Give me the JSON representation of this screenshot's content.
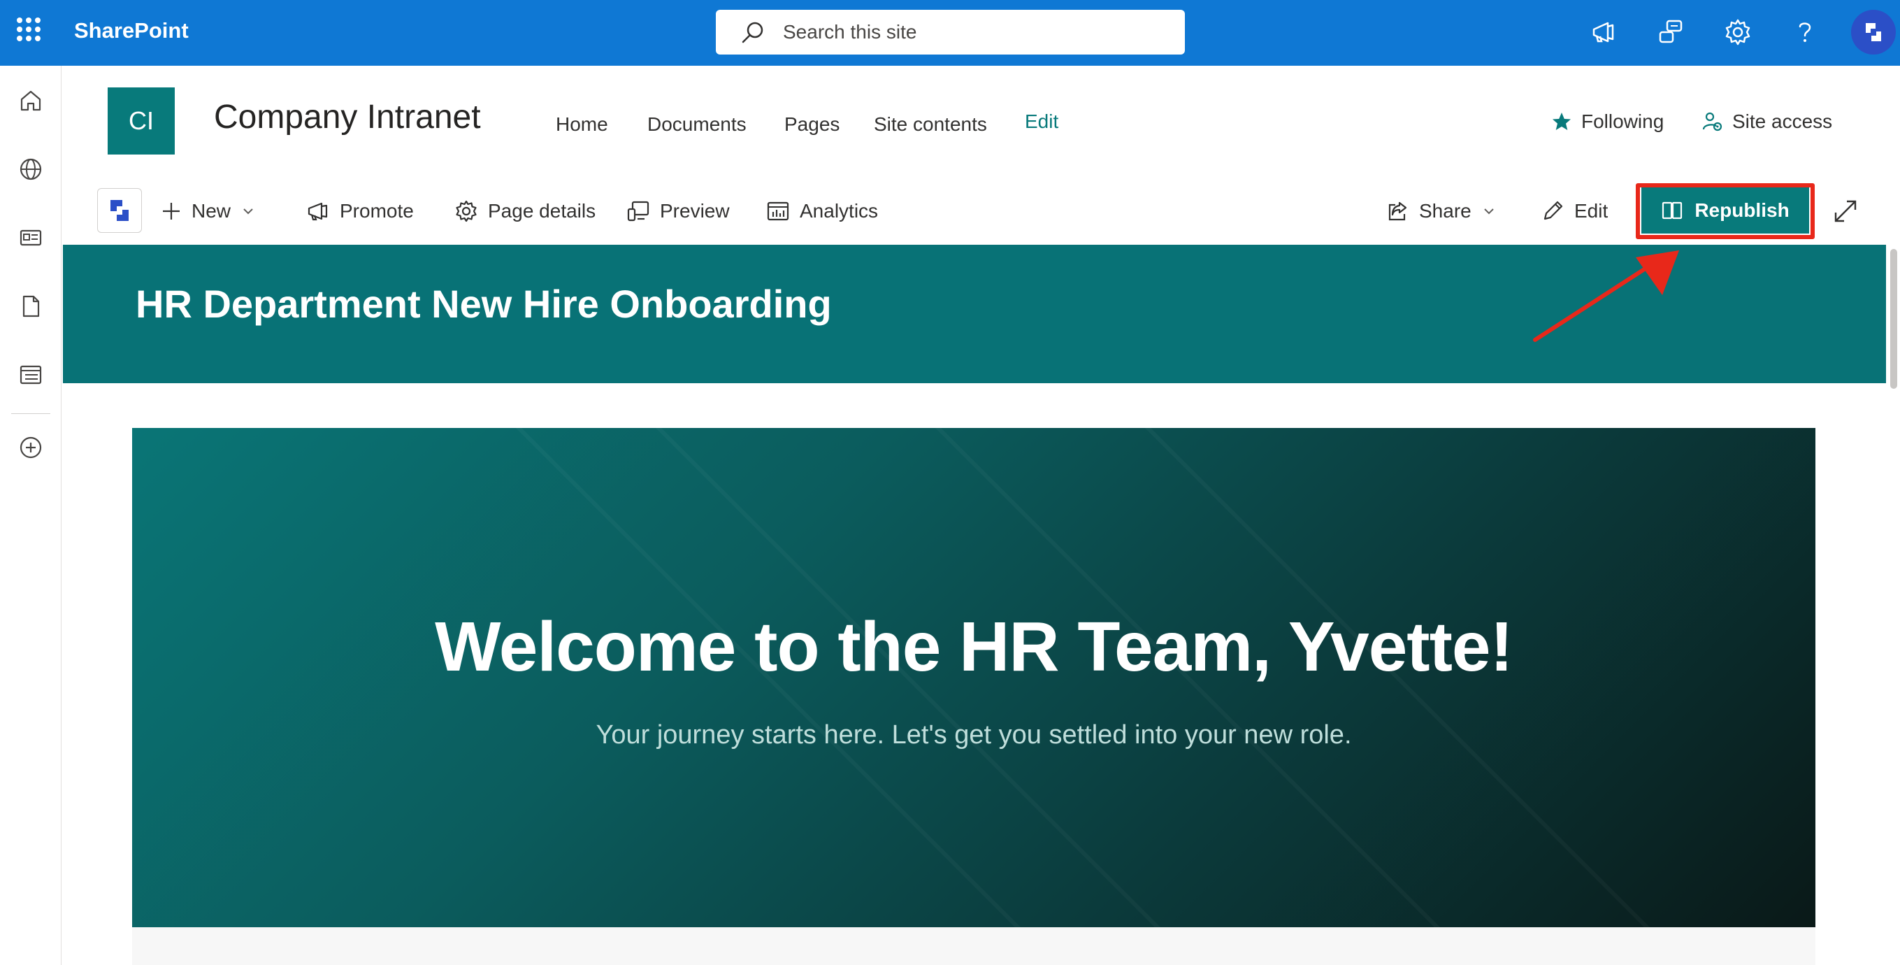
{
  "suite_bar": {
    "app_name": "SharePoint",
    "search": {
      "placeholder": "Search this site",
      "value": ""
    },
    "icons": [
      "megaphone-icon",
      "feedback-icon",
      "gear-icon",
      "help-icon"
    ]
  },
  "site": {
    "logo_initials": "CI",
    "title": "Company Intranet",
    "nav": [
      {
        "label": "Home"
      },
      {
        "label": "Documents"
      },
      {
        "label": "Pages"
      },
      {
        "label": "Site contents"
      },
      {
        "label": "Edit",
        "active": true
      }
    ],
    "following_label": "Following",
    "site_access_label": "Site access"
  },
  "command_bar": {
    "new_label": "New",
    "promote_label": "Promote",
    "page_details_label": "Page details",
    "preview_label": "Preview",
    "analytics_label": "Analytics",
    "share_label": "Share",
    "edit_label": "Edit",
    "republish_label": "Republish"
  },
  "page": {
    "title": "HR Department New Hire Onboarding",
    "hero_title": "Welcome to the HR Team, Yvette!",
    "hero_subtitle": "Your journey starts here. Let's get you settled into your new role."
  },
  "colors": {
    "suite_bar": "#0f78d4",
    "theme_teal": "#087a7b",
    "annotation_red": "#e8281a"
  }
}
